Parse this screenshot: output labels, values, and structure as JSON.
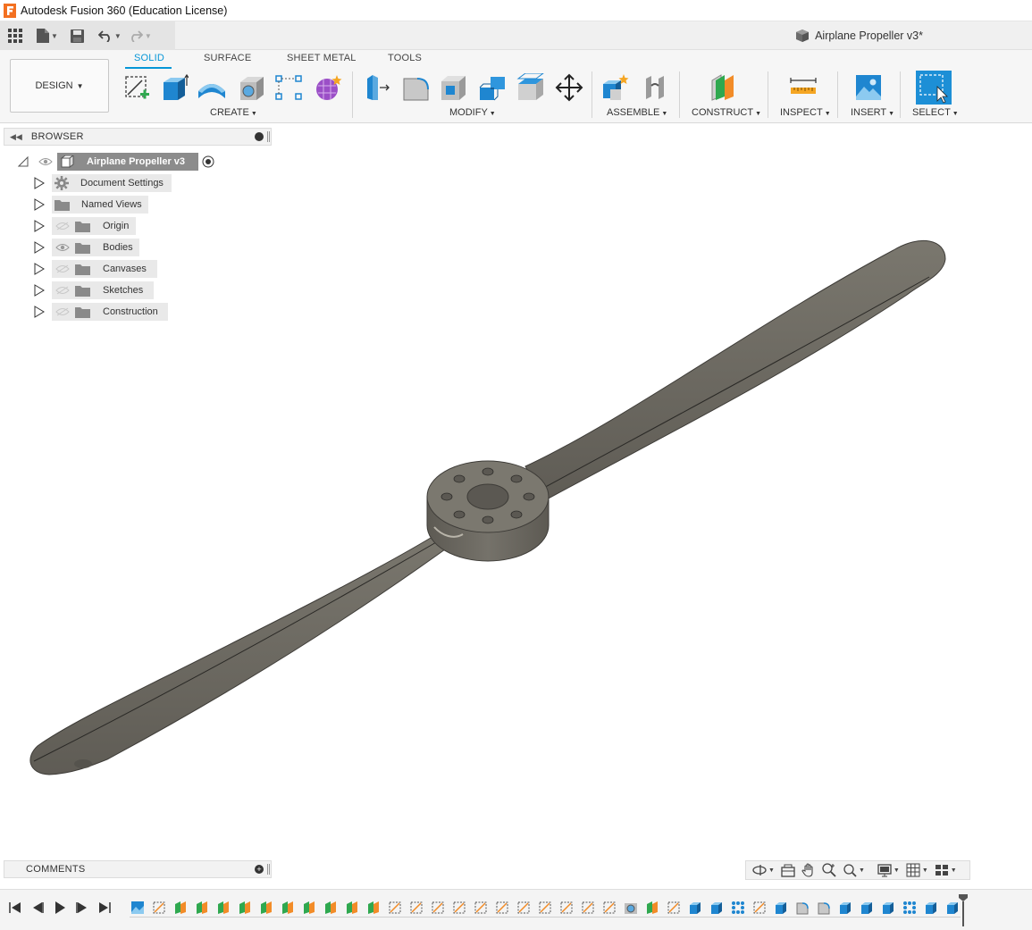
{
  "titlebar": {
    "title": "Autodesk Fusion 360 (Education License)"
  },
  "document": {
    "tab_title": "Airplane Propeller v3*"
  },
  "workspace": {
    "label": "DESIGN"
  },
  "tabs": [
    {
      "label": "SOLID",
      "active": true
    },
    {
      "label": "SURFACE",
      "active": false
    },
    {
      "label": "SHEET METAL",
      "active": false
    },
    {
      "label": "TOOLS",
      "active": false
    }
  ],
  "groups": {
    "create": "CREATE",
    "modify": "MODIFY",
    "assemble": "ASSEMBLE",
    "construct": "CONSTRUCT",
    "inspect": "INSPECT",
    "insert": "INSERT",
    "select": "SELECT"
  },
  "browser": {
    "label": "BROWSER",
    "root": "Airplane Propeller v3",
    "items": [
      {
        "label": "Document Settings",
        "icon": "gear-icon"
      },
      {
        "label": "Named Views",
        "icon": "folder-icon"
      },
      {
        "label": "Origin",
        "icon": "folder-icon"
      },
      {
        "label": "Bodies",
        "icon": "folder-icon"
      },
      {
        "label": "Canvases",
        "icon": "folder-icon"
      },
      {
        "label": "Sketches",
        "icon": "folder-icon"
      },
      {
        "label": "Construction",
        "icon": "folder-icon"
      }
    ]
  },
  "comments": {
    "label": "COMMENTS"
  },
  "colors": {
    "accent": "#0696d7",
    "select_fill": "#1d8fd6",
    "propeller": "#6f6c64"
  },
  "timeline": {
    "feature_count": 39
  }
}
